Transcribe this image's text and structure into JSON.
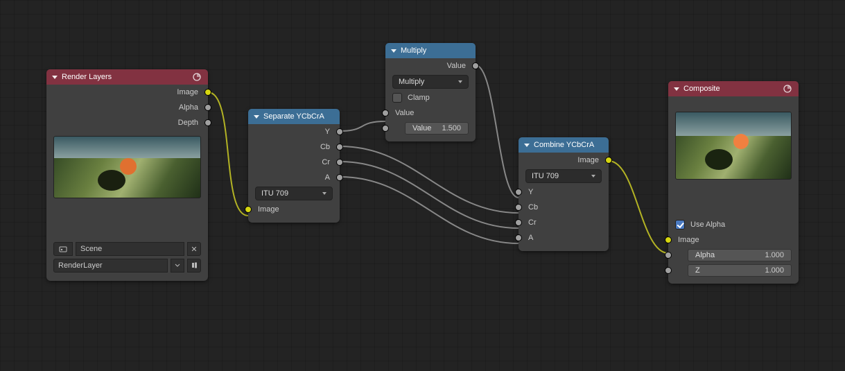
{
  "nodes": {
    "render_layers": {
      "title": "Render Layers",
      "outputs": {
        "image": "Image",
        "alpha": "Alpha",
        "depth": "Depth"
      },
      "scene_field": "Scene",
      "layer_field": "RenderLayer"
    },
    "separate": {
      "title": "Separate YCbCrA",
      "outputs": {
        "y": "Y",
        "cb": "Cb",
        "cr": "Cr",
        "a": "A"
      },
      "mode": "ITU 709",
      "inputs": {
        "image": "Image"
      }
    },
    "multiply": {
      "title": "Multiply",
      "outputs": {
        "value": "Value"
      },
      "mode": "Multiply",
      "clamp_label": "Clamp",
      "clamp_checked": false,
      "inputs": {
        "value_in": "Value",
        "value2_label": "Value",
        "value2_val": "1.500"
      }
    },
    "combine": {
      "title": "Combine YCbCrA",
      "outputs": {
        "image": "Image"
      },
      "mode": "ITU 709",
      "inputs": {
        "y": "Y",
        "cb": "Cb",
        "cr": "Cr",
        "a": "A"
      }
    },
    "composite": {
      "title": "Composite",
      "use_alpha_label": "Use Alpha",
      "use_alpha_checked": true,
      "inputs": {
        "image": "Image",
        "alpha_label": "Alpha",
        "alpha_val": "1.000",
        "z_label": "Z",
        "z_val": "1.000"
      }
    }
  }
}
